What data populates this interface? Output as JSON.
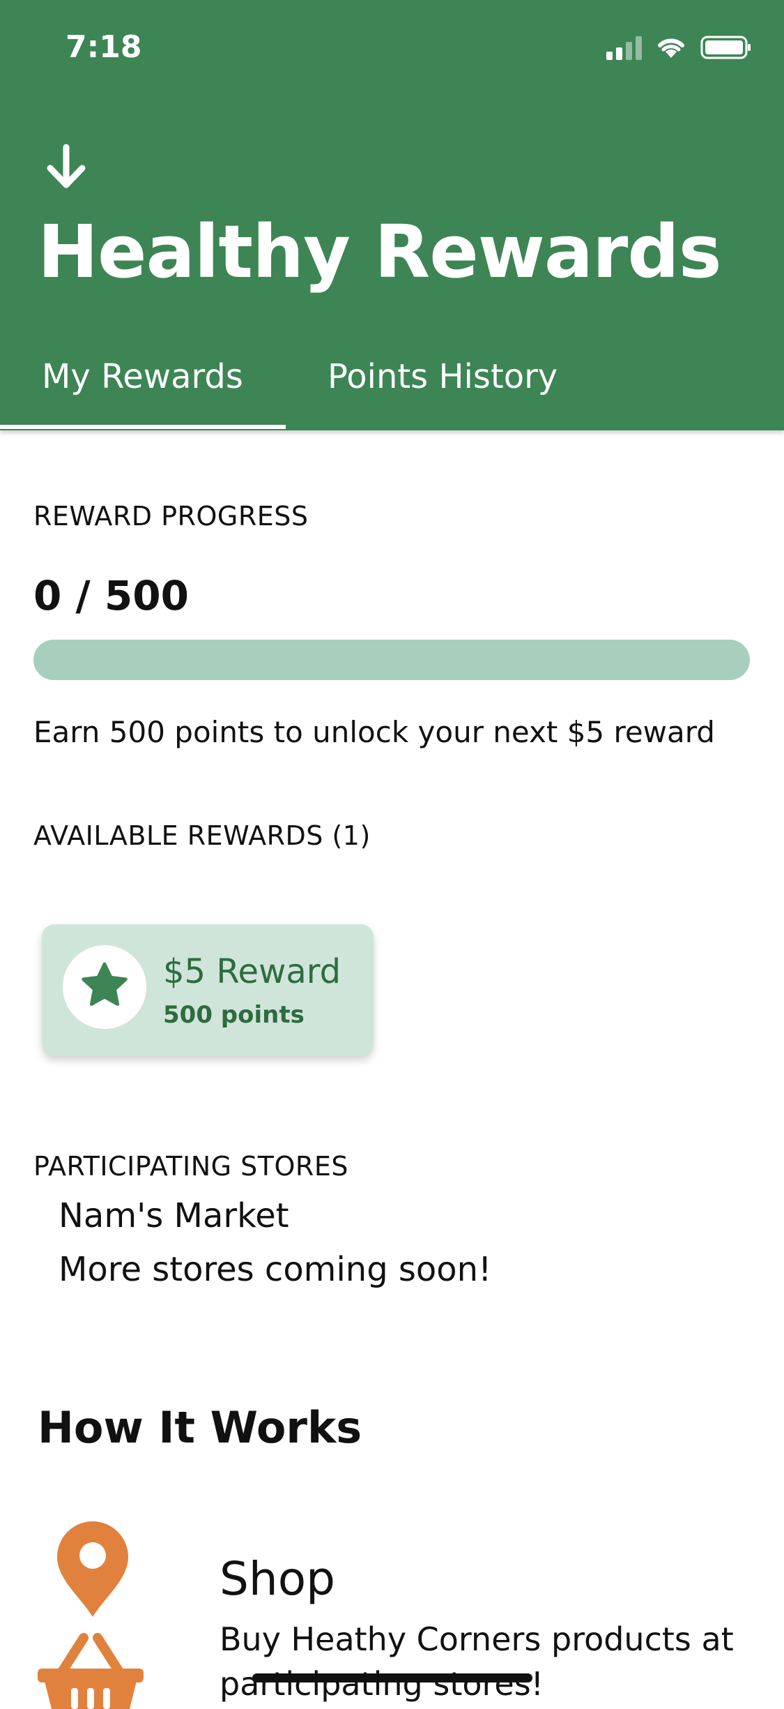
{
  "status_bar": {
    "time": "7:18"
  },
  "header": {
    "title": "Healthy Rewards",
    "tabs": [
      {
        "label": "My Rewards",
        "active": true
      },
      {
        "label": "Points History",
        "active": false
      }
    ]
  },
  "progress": {
    "label": "REWARD PROGRESS",
    "value_text": "0 / 500",
    "current": 0,
    "target": 500,
    "message": "Earn 500 points to unlock your next $5 reward"
  },
  "available": {
    "label": "AVAILABLE REWARDS (1)",
    "rewards": [
      {
        "title": "$5 Reward",
        "points": "500 points"
      }
    ]
  },
  "stores": {
    "label": "PARTICIPATING STORES",
    "items": [
      "Nam's Market",
      "More stores coming soon!"
    ]
  },
  "how_it_works": {
    "title": "How It Works",
    "steps": [
      {
        "title": "Shop",
        "text": "Buy Heathy Corners products at participating stores!"
      }
    ]
  },
  "colors": {
    "header_green": "#3d8554",
    "progress_track": "#a8cfbd",
    "reward_card": "#d0e5da",
    "icon_orange": "#e0813e"
  }
}
